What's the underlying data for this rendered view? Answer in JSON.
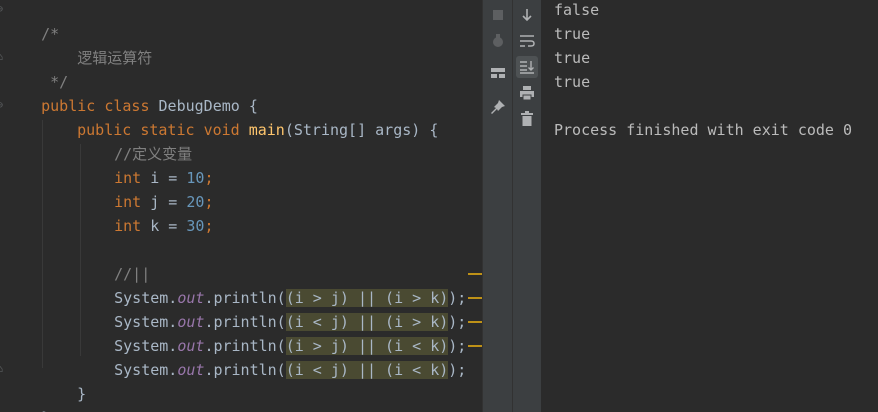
{
  "editor": {
    "comment_open": "/*",
    "comment_text": "    逻辑运算符",
    "comment_close": " */",
    "line_class": {
      "kw1": "public",
      "kw2": "class",
      "name": "DebugDemo",
      "brace": " {"
    },
    "line_main": {
      "kw1": "public",
      "kw2": "static",
      "kw3": "void",
      "name": "main",
      "params": "(String[] args) {"
    },
    "line_cmt_var": "//定义变量",
    "decls": [
      {
        "type": "int",
        "name": " i = ",
        "value": "10",
        "semi": ";"
      },
      {
        "type": "int",
        "name": " j = ",
        "value": "20",
        "semi": ";"
      },
      {
        "type": "int",
        "name": " k = ",
        "value": "30",
        "semi": ";"
      }
    ],
    "line_cmt_or": "//||",
    "prints": [
      {
        "pre": "System.",
        "field": "out",
        "call": ".println(",
        "expr": "(i > j) || (i > k)",
        "end": ");"
      },
      {
        "pre": "System.",
        "field": "out",
        "call": ".println(",
        "expr": "(i < j) || (i > k)",
        "end": ");"
      },
      {
        "pre": "System.",
        "field": "out",
        "call": ".println(",
        "expr": "(i > j) || (i < k)",
        "end": ");"
      },
      {
        "pre": "System.",
        "field": "out",
        "call": ".println(",
        "expr": "(i < j) || (i < k)",
        "end": ");"
      }
    ],
    "close_inner": "}",
    "close_outer": "}"
  },
  "console": {
    "lines": [
      "false",
      "true",
      "true",
      "true"
    ],
    "exit_message": "Process finished with exit code 0"
  },
  "colors": {
    "background": "#2b2b2b",
    "keyword": "#cc7832",
    "function": "#ffc66d",
    "number": "#6897bb",
    "comment": "#808080",
    "static_field": "#9876aa",
    "warning": "#be9117"
  },
  "toolbar_icons": [
    "stop-icon",
    "debug-settings-icon",
    "layout-icon",
    "pin-icon",
    "scroll-down-icon",
    "soft-wrap-icon",
    "scroll-to-end-icon",
    "print-icon",
    "trash-icon"
  ]
}
